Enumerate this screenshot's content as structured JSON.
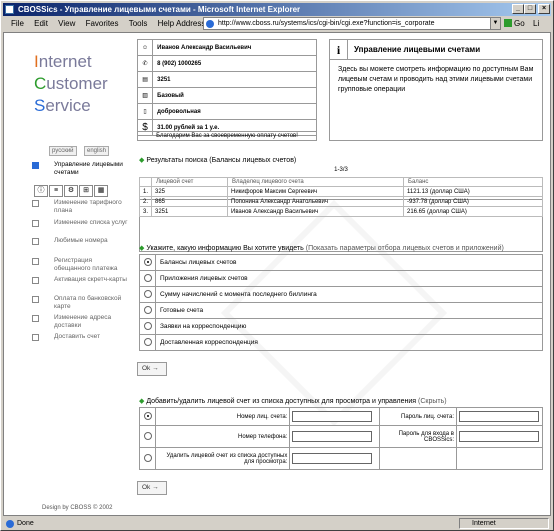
{
  "window": {
    "title": "CBOSSics - Управление лицевыми счетами - Microsoft Internet Explorer"
  },
  "menubar": [
    "File",
    "Edit",
    "View",
    "Favorites",
    "Tools",
    "Help"
  ],
  "address": {
    "label": "Address",
    "url": "http://www.cboss.ru/systems/ics/cgi-bin/cgi.exe?function=is_corporate"
  },
  "go": "Go",
  "links": "Li",
  "logo": {
    "l1": "nternet",
    "l2": "ustomer",
    "l3": "ervice",
    "c1": "I",
    "c2": "C",
    "c3": "S"
  },
  "lang": {
    "ru": "русский",
    "en": "english"
  },
  "info": {
    "name": "Иванов Александр Васильевич",
    "phone": "8 (902) 1000265",
    "account": "3251",
    "plan": "Базовый",
    "voluntary": "добровольная",
    "balance": "31.00 рублей за 1 у.е.",
    "thanks": "Благодарим Вас за своевременную оплату счетов!"
  },
  "infobox": {
    "title": "Управление лицевыми счетами",
    "text": "Здесь вы можете смотреть информацию по доступным Вам лицевым счетам и проводить над этими лицевыми счетами групповые операции"
  },
  "menu": [
    "Управление лицевыми счетами",
    "Изменение тарифного плана",
    "Изменение списка услуг",
    "Любимые номера",
    "Регистрация обещанного платежа",
    "Активация скретч-карты",
    "Оплата по банковской карте",
    "Изменение адреса доставки",
    "Доставить счет"
  ],
  "results": {
    "title": "Результаты поиска",
    "subtitle": "(Балансы лицевых счетов)",
    "range": "1-3/3",
    "headers": [
      "Лицевой счет",
      "Владелец лицевого счета",
      "Баланс"
    ],
    "rows": [
      {
        "n": "1.",
        "acc": "325",
        "owner": "Никифоров Максим Сергеевич",
        "bal": "1121.13 (доллар США)"
      },
      {
        "n": "2.",
        "acc": "865",
        "owner": "Попонина Александр Анатольевич",
        "bal": "-937.78 (доллар США)"
      },
      {
        "n": "3.",
        "acc": "3251",
        "owner": "Иванов Александр Васильевич",
        "bal": "216.65 (доллар США)"
      }
    ]
  },
  "choose": {
    "title": "Укажите, какую информацию Вы хотите увидеть",
    "link": "(Показать параметры отбора лицевых счетов и приложений)",
    "options": [
      "Балансы лицевых счетов",
      "Приложения лицевых счетов",
      "Сумму начислений с момента последнего биллинга",
      "Готовые счета",
      "Заявки на корреспонденцию",
      "Доставленная корреспонденция"
    ]
  },
  "ok": "Ok",
  "add": {
    "title": "Добавить/удалить лицевой счет из списка доступных для просмотра и управления",
    "hide": "(Скрыть)",
    "acc_label": "Номер лиц. счета:",
    "pwd_label": "Пароль лиц. счета:",
    "phone_label": "Номер телефона:",
    "cboss_pwd_label": "Пароль для входа в CBOSSics:",
    "delete_label": "Удалить лицевой счет из списка доступных для просмотра:"
  },
  "footer": "Design by CBOSS © 2002",
  "status": {
    "done": "Done",
    "zone": "Internet"
  }
}
